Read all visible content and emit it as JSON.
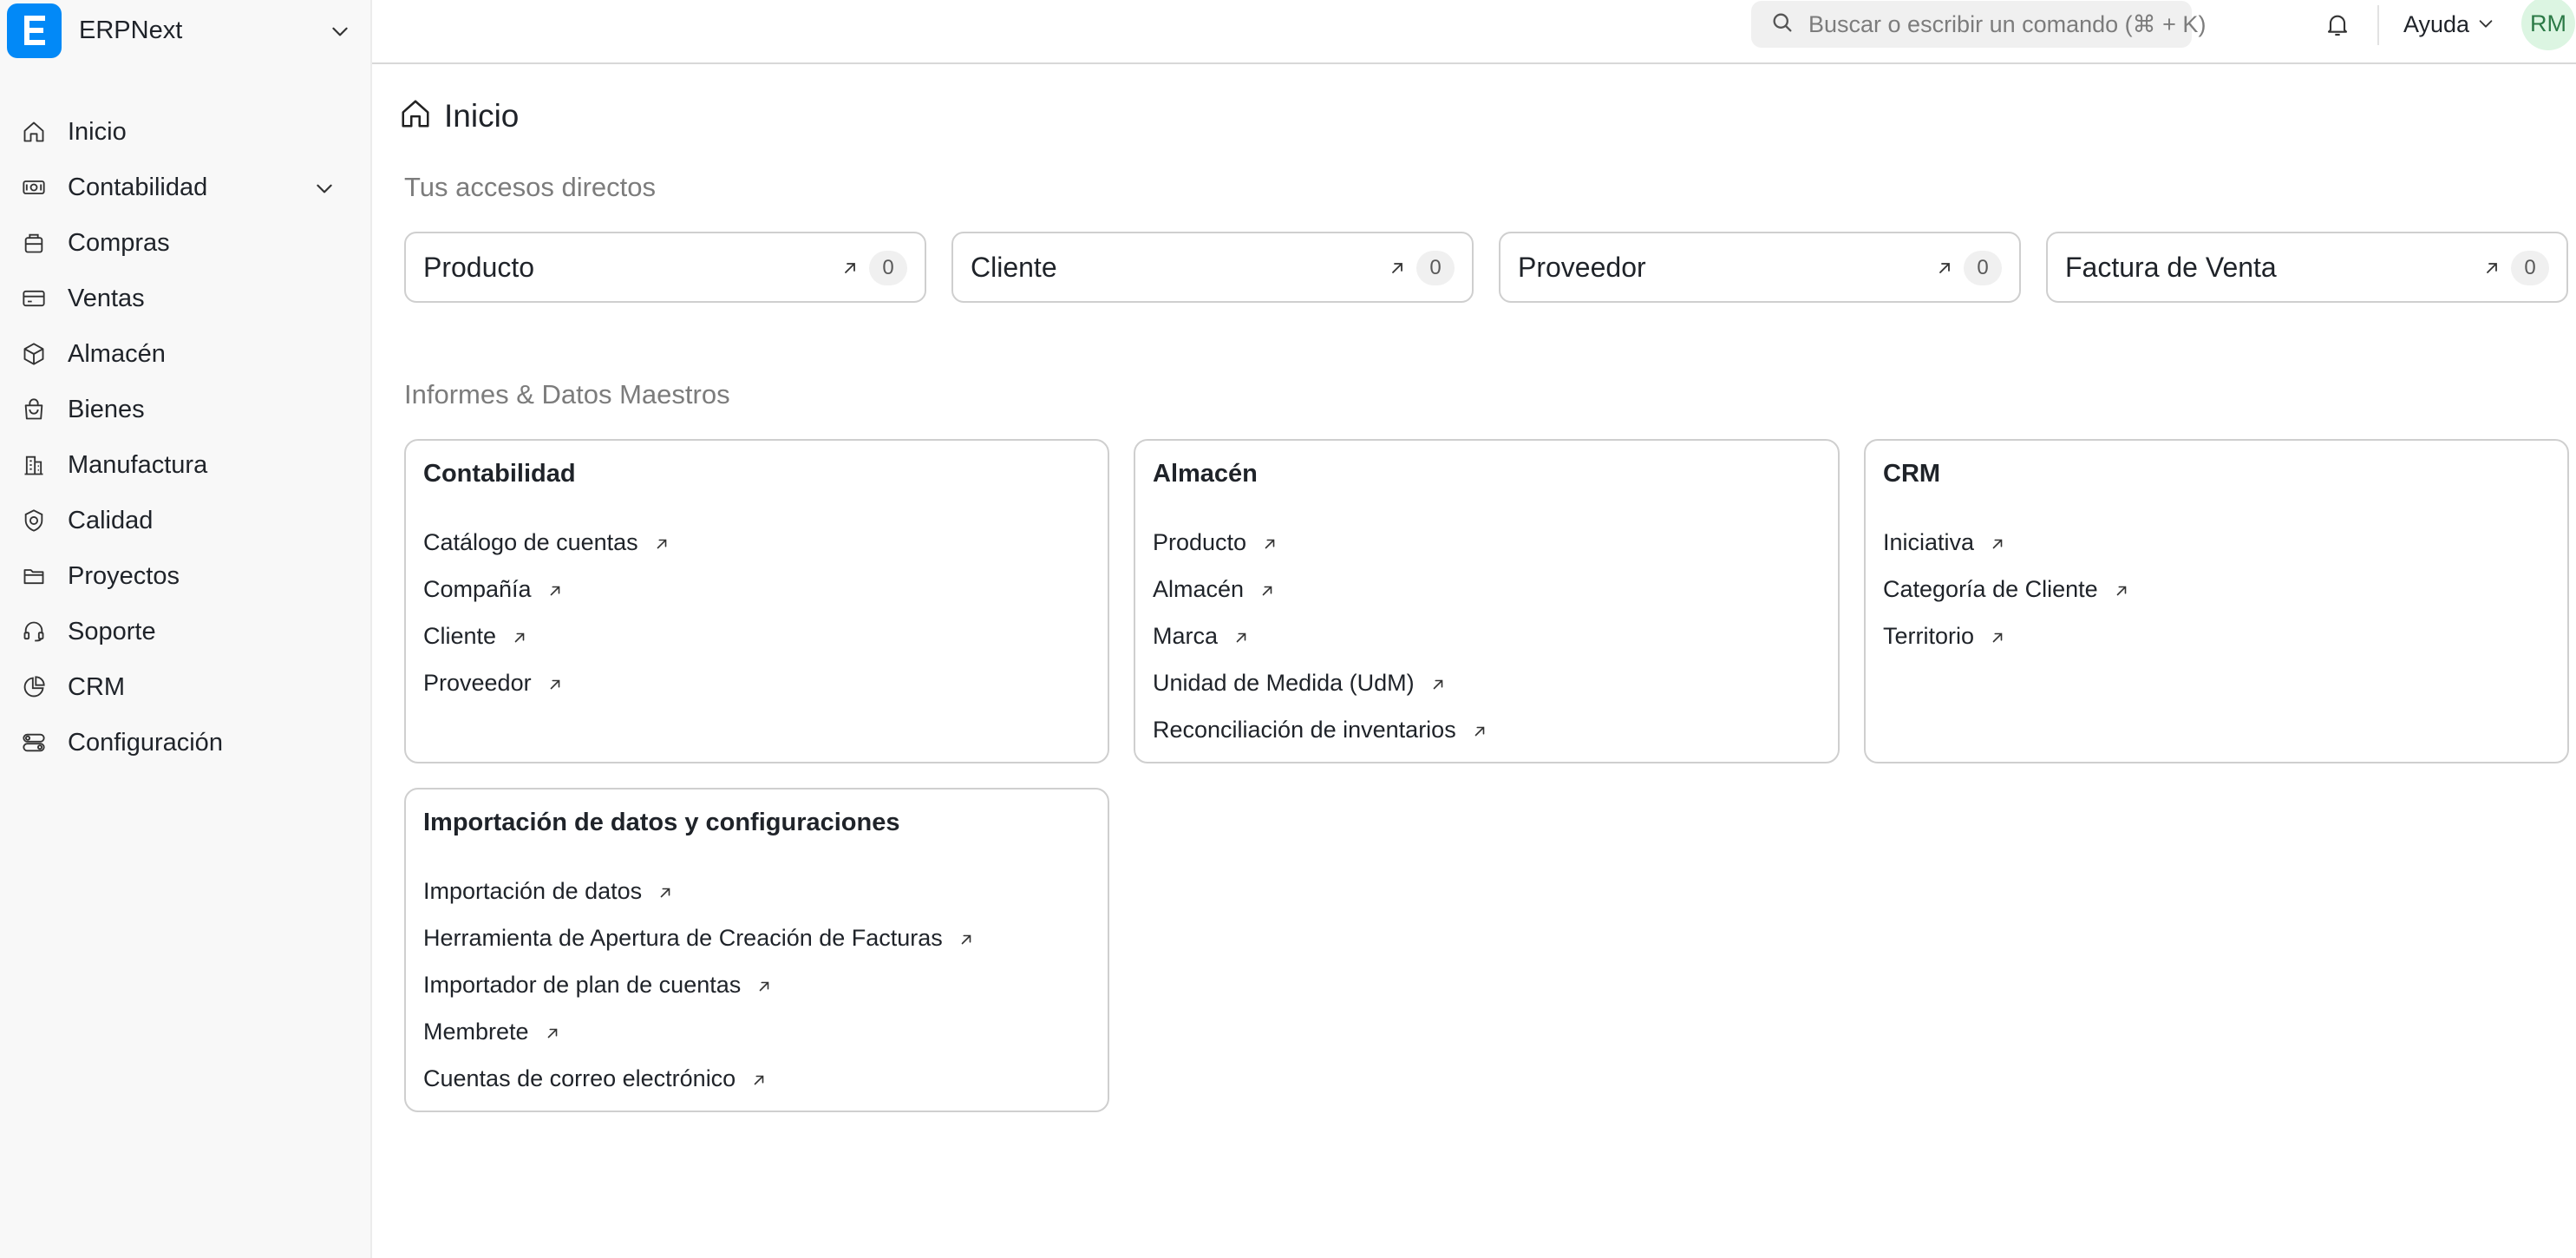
{
  "sidebar": {
    "brand": "ERPNext",
    "items": [
      {
        "label": "Inicio",
        "icon": "home-icon"
      },
      {
        "label": "Contabilidad",
        "icon": "accounting-icon"
      },
      {
        "label": "Compras",
        "icon": "buying-icon"
      },
      {
        "label": "Ventas",
        "icon": "selling-icon"
      },
      {
        "label": "Almacén",
        "icon": "stock-icon"
      },
      {
        "label": "Bienes",
        "icon": "assets-icon"
      },
      {
        "label": "Manufactura",
        "icon": "manufacturing-icon"
      },
      {
        "label": "Calidad",
        "icon": "quality-icon"
      },
      {
        "label": "Proyectos",
        "icon": "projects-icon"
      },
      {
        "label": "Soporte",
        "icon": "support-icon"
      },
      {
        "label": "CRM",
        "icon": "crm-icon"
      },
      {
        "label": "Configuración",
        "icon": "settings-icon"
      }
    ]
  },
  "topbar": {
    "search_placeholder": "Buscar o escribir un comando (⌘ + K)",
    "help_label": "Ayuda",
    "avatar_initials": "RM"
  },
  "page": {
    "title": "Inicio",
    "shortcuts_title": "Tus accesos directos",
    "reports_title": "Informes & Datos Maestros"
  },
  "shortcuts": [
    {
      "label": "Producto",
      "count": "0"
    },
    {
      "label": "Cliente",
      "count": "0"
    },
    {
      "label": "Proveedor",
      "count": "0"
    },
    {
      "label": "Factura de Venta",
      "count": "0"
    }
  ],
  "cards": [
    {
      "title": "Contabilidad",
      "links": [
        "Catálogo de cuentas",
        "Compañía",
        "Cliente",
        "Proveedor"
      ]
    },
    {
      "title": "Almacén",
      "links": [
        "Producto",
        "Almacén",
        "Marca",
        "Unidad de Medida (UdM)",
        "Reconciliación de inventarios"
      ]
    },
    {
      "title": "CRM",
      "links": [
        "Iniciativa",
        "Categoría de Cliente",
        "Territorio"
      ]
    },
    {
      "title": "Importación de datos y configuraciones",
      "links": [
        "Importación de datos",
        "Herramienta de Apertura de Creación de Facturas",
        "Importador de plan de cuentas",
        "Membrete",
        "Cuentas de correo electrónico"
      ]
    }
  ],
  "colors": {
    "brand": "#0289f7",
    "avatar_bg": "#dcf5e2",
    "avatar_text": "#2c7a47"
  }
}
